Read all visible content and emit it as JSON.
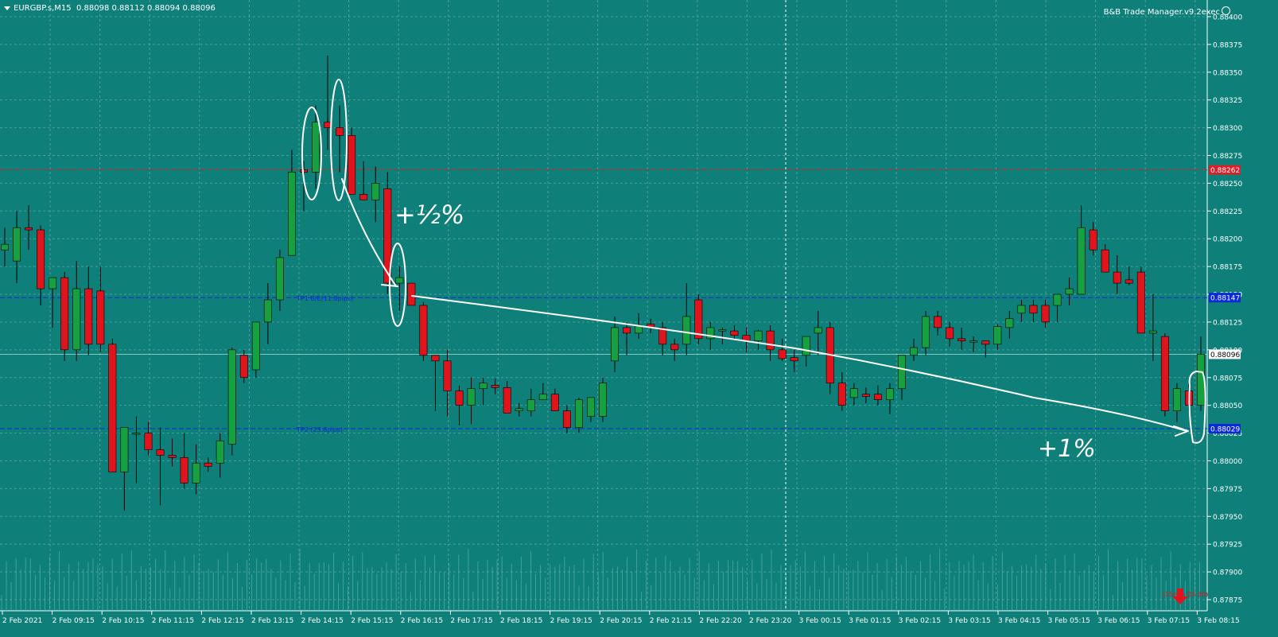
{
  "chart_header": {
    "symbol": "EURGBP.s,M15",
    "ohlc": "0.88098 0.88112 0.88094 0.88096"
  },
  "ea_label": "B&B Trade Manager.v9.2exec",
  "colors": {
    "background": "#0e8079",
    "grid": "#7fb8b4",
    "bull": "#17a040",
    "bear": "#e0141c",
    "wick": "#000000",
    "tp_line": "#0a2ad8",
    "sl_line": "#d8202a",
    "annotation": "#ffffff"
  },
  "price_levels": {
    "sl": {
      "price": 0.88262,
      "label": "0.88262"
    },
    "tp1": {
      "price": 0.88147,
      "label": "0.88147",
      "text": "TP1 B/E(11.8pips)"
    },
    "current": {
      "price": 0.88096,
      "label": "0.88096"
    },
    "tp2": {
      "price": 0.88029,
      "label": "0.88029",
      "text": "TP2 (23.8pips)"
    }
  },
  "timer_text": "(15min 03:30)",
  "annotations": {
    "half_percent": "+½%",
    "one_percent": "+1%"
  },
  "chart_data": {
    "type": "candlestick",
    "symbol": "EURGBP.s",
    "timeframe": "M15",
    "ylim": [
      0.87875,
      0.88415
    ],
    "y_ticks": [
      "0.88400",
      "0.88375",
      "0.88350",
      "0.88325",
      "0.88300",
      "0.88275",
      "0.88250",
      "0.88225",
      "0.88200",
      "0.88175",
      "0.88150",
      "0.88125",
      "0.88100",
      "0.88075",
      "0.88050",
      "0.88025",
      "0.88000",
      "0.87975",
      "0.87950",
      "0.87925",
      "0.87900",
      "0.87875"
    ],
    "x_ticks": [
      "2 Feb 2021",
      "2 Feb 09:15",
      "2 Feb 10:15",
      "2 Feb 11:15",
      "2 Feb 12:15",
      "2 Feb 13:15",
      "2 Feb 14:15",
      "2 Feb 15:15",
      "2 Feb 16:15",
      "2 Feb 17:15",
      "2 Feb 18:15",
      "2 Feb 19:15",
      "2 Feb 20:15",
      "2 Feb 21:15",
      "2 Feb 22:20",
      "2 Feb 23:20",
      "3 Feb 00:15",
      "3 Feb 01:15",
      "3 Feb 02:15",
      "3 Feb 03:15",
      "3 Feb 04:15",
      "3 Feb 05:15",
      "3 Feb 06:15",
      "3 Feb 07:15",
      "3 Feb 08:15"
    ],
    "candles": [
      [
        0.8819,
        0.8821,
        0.88175,
        0.88195
      ],
      [
        0.8818,
        0.88225,
        0.8816,
        0.8821
      ],
      [
        0.8821,
        0.8823,
        0.8819,
        0.88208
      ],
      [
        0.88208,
        0.88212,
        0.8814,
        0.88155
      ],
      [
        0.88155,
        0.8816,
        0.8812,
        0.88165
      ],
      [
        0.88165,
        0.8817,
        0.8809,
        0.881
      ],
      [
        0.881,
        0.8818,
        0.8809,
        0.88155
      ],
      [
        0.88155,
        0.88175,
        0.88095,
        0.88105
      ],
      [
        0.88153,
        0.88175,
        0.88098,
        0.88105
      ],
      [
        0.88105,
        0.8811,
        0.8799,
        0.8799
      ],
      [
        0.8799,
        0.8803,
        0.87955,
        0.8803
      ],
      [
        0.88025,
        0.8804,
        0.8798,
        0.88025
      ],
      [
        0.88025,
        0.88035,
        0.88005,
        0.8801
      ],
      [
        0.8801,
        0.8803,
        0.8796,
        0.88005
      ],
      [
        0.88005,
        0.8802,
        0.87995,
        0.88003
      ],
      [
        0.88003,
        0.88025,
        0.87975,
        0.8798
      ],
      [
        0.8798,
        0.88015,
        0.8797,
        0.87998
      ],
      [
        0.87998,
        0.88003,
        0.8799,
        0.87995
      ],
      [
        0.87998,
        0.88025,
        0.87985,
        0.88018
      ],
      [
        0.88015,
        0.88102,
        0.88005,
        0.881
      ],
      [
        0.88095,
        0.881,
        0.8807,
        0.88075
      ],
      [
        0.88082,
        0.88125,
        0.88075,
        0.88125
      ],
      [
        0.88125,
        0.8816,
        0.88105,
        0.88145
      ],
      [
        0.88145,
        0.8819,
        0.88135,
        0.88183
      ],
      [
        0.88185,
        0.8828,
        0.8819,
        0.8826
      ],
      [
        0.88262,
        0.8827,
        0.88225,
        0.8826
      ],
      [
        0.8826,
        0.8832,
        0.88245,
        0.88305
      ],
      [
        0.88305,
        0.88365,
        0.8828,
        0.883
      ],
      [
        0.883,
        0.8832,
        0.8826,
        0.88293
      ],
      [
        0.88293,
        0.883,
        0.8825,
        0.8824
      ],
      [
        0.8824,
        0.8827,
        0.88235,
        0.88235
      ],
      [
        0.88235,
        0.88265,
        0.88215,
        0.8825
      ],
      [
        0.88245,
        0.8826,
        0.8815,
        0.8816
      ],
      [
        0.8816,
        0.88175,
        0.88135,
        0.88165
      ],
      [
        0.8816,
        0.8816,
        0.8814,
        0.8814
      ],
      [
        0.8814,
        0.88143,
        0.8809,
        0.88095
      ],
      [
        0.88095,
        0.88095,
        0.88045,
        0.8809
      ],
      [
        0.8809,
        0.881,
        0.8804,
        0.88063
      ],
      [
        0.88063,
        0.88068,
        0.88032,
        0.8805
      ],
      [
        0.8805,
        0.88075,
        0.88033,
        0.88065
      ],
      [
        0.88065,
        0.88075,
        0.8805,
        0.8807
      ],
      [
        0.88068,
        0.88074,
        0.8806,
        0.88066
      ],
      [
        0.88066,
        0.88072,
        0.88043,
        0.88043
      ],
      [
        0.88045,
        0.88052,
        0.8804,
        0.88047
      ],
      [
        0.88045,
        0.88065,
        0.8804,
        0.88055
      ],
      [
        0.88055,
        0.8807,
        0.88055,
        0.8806
      ],
      [
        0.8806,
        0.88065,
        0.88045,
        0.88045
      ],
      [
        0.88045,
        0.8805,
        0.88025,
        0.8803
      ],
      [
        0.8803,
        0.88057,
        0.88025,
        0.88055
      ],
      [
        0.8804,
        0.88057,
        0.88035,
        0.88057
      ],
      [
        0.8804,
        0.88075,
        0.88035,
        0.8807
      ],
      [
        0.8809,
        0.8813,
        0.8808,
        0.8812
      ],
      [
        0.8812,
        0.88125,
        0.88095,
        0.88115
      ],
      [
        0.88115,
        0.88133,
        0.8811,
        0.88122
      ],
      [
        0.88123,
        0.88128,
        0.88115,
        0.8812
      ],
      [
        0.8812,
        0.88125,
        0.88095,
        0.88105
      ],
      [
        0.88105,
        0.8811,
        0.8809,
        0.881
      ],
      [
        0.88105,
        0.8816,
        0.88095,
        0.8813
      ],
      [
        0.88145,
        0.8815,
        0.88105,
        0.8811
      ],
      [
        0.8811,
        0.88125,
        0.881,
        0.8812
      ],
      [
        0.88117,
        0.8812,
        0.88105,
        0.88118
      ],
      [
        0.88117,
        0.88122,
        0.8811,
        0.88113
      ],
      [
        0.88113,
        0.8812,
        0.88098,
        0.88108
      ],
      [
        0.88108,
        0.88118,
        0.881,
        0.88117
      ],
      [
        0.88117,
        0.88122,
        0.8809,
        0.881
      ],
      [
        0.881,
        0.8811,
        0.8809,
        0.88092
      ],
      [
        0.88093,
        0.881,
        0.8808,
        0.8809
      ],
      [
        0.88095,
        0.8811,
        0.88085,
        0.88112
      ],
      [
        0.88115,
        0.88135,
        0.88095,
        0.8812
      ],
      [
        0.8812,
        0.88125,
        0.8806,
        0.8807
      ],
      [
        0.8807,
        0.8808,
        0.88045,
        0.8805
      ],
      [
        0.88057,
        0.8807,
        0.8805,
        0.88065
      ],
      [
        0.8806,
        0.88066,
        0.88052,
        0.88058
      ],
      [
        0.8806,
        0.88068,
        0.8805,
        0.88055
      ],
      [
        0.88055,
        0.8807,
        0.88042,
        0.88065
      ],
      [
        0.88065,
        0.88095,
        0.88055,
        0.88095
      ],
      [
        0.88095,
        0.8811,
        0.8809,
        0.88102
      ],
      [
        0.88102,
        0.88135,
        0.88095,
        0.8813
      ],
      [
        0.8813,
        0.88135,
        0.88113,
        0.8812
      ],
      [
        0.8812,
        0.88125,
        0.88103,
        0.8811
      ],
      [
        0.8811,
        0.8812,
        0.881,
        0.88108
      ],
      [
        0.88108,
        0.88112,
        0.88098,
        0.88108
      ],
      [
        0.88108,
        0.88108,
        0.88093,
        0.88105
      ],
      [
        0.88105,
        0.88123,
        0.881,
        0.88121
      ],
      [
        0.8812,
        0.88135,
        0.8811,
        0.88128
      ],
      [
        0.88133,
        0.88145,
        0.88125,
        0.8814
      ],
      [
        0.8814,
        0.88145,
        0.88125,
        0.88133
      ],
      [
        0.8814,
        0.88145,
        0.8812,
        0.88125
      ],
      [
        0.8814,
        0.88145,
        0.88125,
        0.8815
      ],
      [
        0.8815,
        0.88165,
        0.8814,
        0.88155
      ],
      [
        0.8815,
        0.8823,
        0.8815,
        0.8821
      ],
      [
        0.88208,
        0.88215,
        0.88185,
        0.8819
      ],
      [
        0.8819,
        0.88195,
        0.8817,
        0.8817
      ],
      [
        0.8817,
        0.88185,
        0.8815,
        0.8816
      ],
      [
        0.88163,
        0.88175,
        0.88158,
        0.8816
      ],
      [
        0.8817,
        0.88175,
        0.8814,
        0.88115
      ],
      [
        0.88115,
        0.8815,
        0.8809,
        0.88117
      ],
      [
        0.88112,
        0.88115,
        0.8804,
        0.88045
      ],
      [
        0.88045,
        0.8807,
        0.88035,
        0.88065
      ],
      [
        0.88063,
        0.8807,
        0.88045,
        0.8805
      ],
      [
        0.8805,
        0.88112,
        0.88045,
        0.88096
      ]
    ]
  }
}
